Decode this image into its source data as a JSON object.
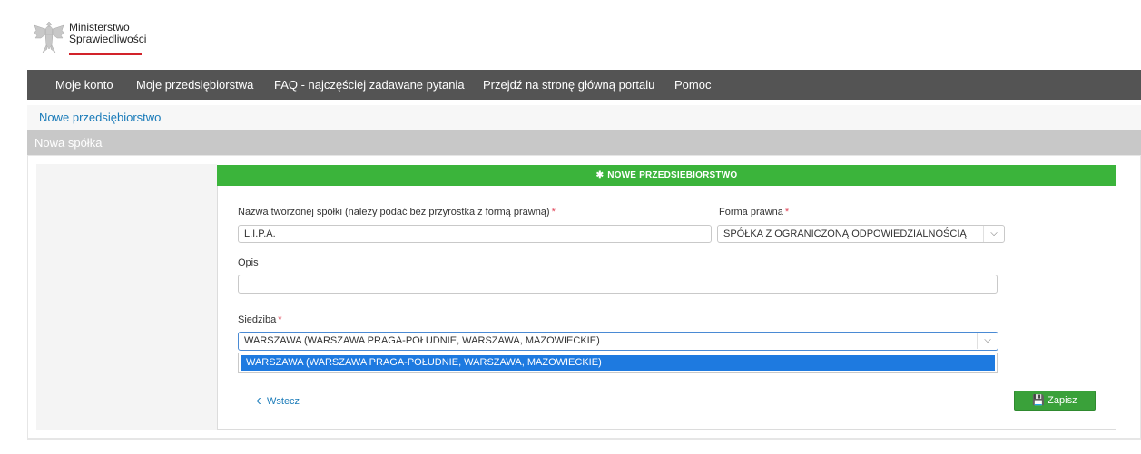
{
  "logo": {
    "line1": "Ministerstwo",
    "line2": "Sprawiedliwości"
  },
  "nav": [
    {
      "label": "Moje konto"
    },
    {
      "label": "Moje przedsiębiorstwa"
    },
    {
      "label": "FAQ - najczęściej zadawane pytania"
    },
    {
      "label": "Przejdź na stronę główną portalu"
    },
    {
      "label": "Pomoc"
    }
  ],
  "breadcrumb": "Nowe przedsiębiorstwo",
  "section_title": "Nowa spółka",
  "panel": {
    "title": "NOWE PRZEDSIĘBIORSTWO",
    "icon": "gear-icon"
  },
  "form": {
    "name_label": "Nazwa tworzonej spółki (należy podać bez przyrostka z formą prawną)",
    "name_value": "L.I.P.A.",
    "legal_form_label": "Forma prawna",
    "legal_form_value": "SPÓŁKA Z OGRANICZONĄ ODPOWIEDZIALNOŚCIĄ",
    "description_label": "Opis",
    "description_value": "",
    "seat_label": "Siedziba",
    "seat_value": "WARSZAWA (WARSZAWA PRAGA-POŁUDNIE, WARSZAWA, MAZOWIECKIE)",
    "seat_options": [
      "WARSZAWA (WARSZAWA PRAGA-POŁUDNIE, WARSZAWA, MAZOWIECKIE)"
    ],
    "required_mark": "*"
  },
  "actions": {
    "back_label": "Wstecz",
    "save_label": "Zapisz"
  },
  "colors": {
    "nav_bg": "#545454",
    "panel_header": "#3bb43b",
    "save_button": "#3aa13a",
    "link": "#1a7bb9",
    "highlight": "#1e7ae0",
    "required": "#e0475a"
  }
}
